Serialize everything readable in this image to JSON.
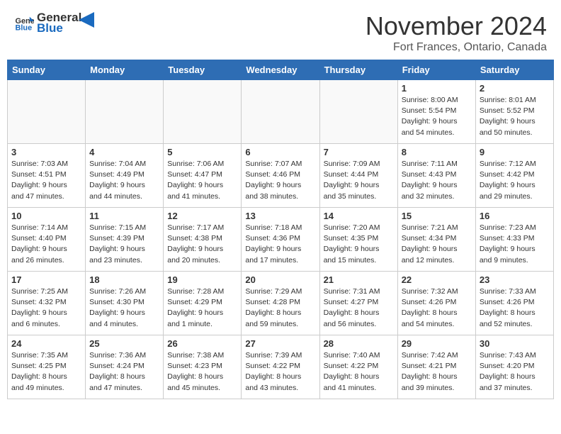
{
  "header": {
    "logo_general": "General",
    "logo_blue": "Blue",
    "month_title": "November 2024",
    "location": "Fort Frances, Ontario, Canada"
  },
  "days_of_week": [
    "Sunday",
    "Monday",
    "Tuesday",
    "Wednesday",
    "Thursday",
    "Friday",
    "Saturday"
  ],
  "weeks": [
    [
      {
        "day": "",
        "info": ""
      },
      {
        "day": "",
        "info": ""
      },
      {
        "day": "",
        "info": ""
      },
      {
        "day": "",
        "info": ""
      },
      {
        "day": "",
        "info": ""
      },
      {
        "day": "1",
        "info": "Sunrise: 8:00 AM\nSunset: 5:54 PM\nDaylight: 9 hours\nand 54 minutes."
      },
      {
        "day": "2",
        "info": "Sunrise: 8:01 AM\nSunset: 5:52 PM\nDaylight: 9 hours\nand 50 minutes."
      }
    ],
    [
      {
        "day": "3",
        "info": "Sunrise: 7:03 AM\nSunset: 4:51 PM\nDaylight: 9 hours\nand 47 minutes."
      },
      {
        "day": "4",
        "info": "Sunrise: 7:04 AM\nSunset: 4:49 PM\nDaylight: 9 hours\nand 44 minutes."
      },
      {
        "day": "5",
        "info": "Sunrise: 7:06 AM\nSunset: 4:47 PM\nDaylight: 9 hours\nand 41 minutes."
      },
      {
        "day": "6",
        "info": "Sunrise: 7:07 AM\nSunset: 4:46 PM\nDaylight: 9 hours\nand 38 minutes."
      },
      {
        "day": "7",
        "info": "Sunrise: 7:09 AM\nSunset: 4:44 PM\nDaylight: 9 hours\nand 35 minutes."
      },
      {
        "day": "8",
        "info": "Sunrise: 7:11 AM\nSunset: 4:43 PM\nDaylight: 9 hours\nand 32 minutes."
      },
      {
        "day": "9",
        "info": "Sunrise: 7:12 AM\nSunset: 4:42 PM\nDaylight: 9 hours\nand 29 minutes."
      }
    ],
    [
      {
        "day": "10",
        "info": "Sunrise: 7:14 AM\nSunset: 4:40 PM\nDaylight: 9 hours\nand 26 minutes."
      },
      {
        "day": "11",
        "info": "Sunrise: 7:15 AM\nSunset: 4:39 PM\nDaylight: 9 hours\nand 23 minutes."
      },
      {
        "day": "12",
        "info": "Sunrise: 7:17 AM\nSunset: 4:38 PM\nDaylight: 9 hours\nand 20 minutes."
      },
      {
        "day": "13",
        "info": "Sunrise: 7:18 AM\nSunset: 4:36 PM\nDaylight: 9 hours\nand 17 minutes."
      },
      {
        "day": "14",
        "info": "Sunrise: 7:20 AM\nSunset: 4:35 PM\nDaylight: 9 hours\nand 15 minutes."
      },
      {
        "day": "15",
        "info": "Sunrise: 7:21 AM\nSunset: 4:34 PM\nDaylight: 9 hours\nand 12 minutes."
      },
      {
        "day": "16",
        "info": "Sunrise: 7:23 AM\nSunset: 4:33 PM\nDaylight: 9 hours\nand 9 minutes."
      }
    ],
    [
      {
        "day": "17",
        "info": "Sunrise: 7:25 AM\nSunset: 4:32 PM\nDaylight: 9 hours\nand 6 minutes."
      },
      {
        "day": "18",
        "info": "Sunrise: 7:26 AM\nSunset: 4:30 PM\nDaylight: 9 hours\nand 4 minutes."
      },
      {
        "day": "19",
        "info": "Sunrise: 7:28 AM\nSunset: 4:29 PM\nDaylight: 9 hours\nand 1 minute."
      },
      {
        "day": "20",
        "info": "Sunrise: 7:29 AM\nSunset: 4:28 PM\nDaylight: 8 hours\nand 59 minutes."
      },
      {
        "day": "21",
        "info": "Sunrise: 7:31 AM\nSunset: 4:27 PM\nDaylight: 8 hours\nand 56 minutes."
      },
      {
        "day": "22",
        "info": "Sunrise: 7:32 AM\nSunset: 4:26 PM\nDaylight: 8 hours\nand 54 minutes."
      },
      {
        "day": "23",
        "info": "Sunrise: 7:33 AM\nSunset: 4:26 PM\nDaylight: 8 hours\nand 52 minutes."
      }
    ],
    [
      {
        "day": "24",
        "info": "Sunrise: 7:35 AM\nSunset: 4:25 PM\nDaylight: 8 hours\nand 49 minutes."
      },
      {
        "day": "25",
        "info": "Sunrise: 7:36 AM\nSunset: 4:24 PM\nDaylight: 8 hours\nand 47 minutes."
      },
      {
        "day": "26",
        "info": "Sunrise: 7:38 AM\nSunset: 4:23 PM\nDaylight: 8 hours\nand 45 minutes."
      },
      {
        "day": "27",
        "info": "Sunrise: 7:39 AM\nSunset: 4:22 PM\nDaylight: 8 hours\nand 43 minutes."
      },
      {
        "day": "28",
        "info": "Sunrise: 7:40 AM\nSunset: 4:22 PM\nDaylight: 8 hours\nand 41 minutes."
      },
      {
        "day": "29",
        "info": "Sunrise: 7:42 AM\nSunset: 4:21 PM\nDaylight: 8 hours\nand 39 minutes."
      },
      {
        "day": "30",
        "info": "Sunrise: 7:43 AM\nSunset: 4:20 PM\nDaylight: 8 hours\nand 37 minutes."
      }
    ]
  ]
}
